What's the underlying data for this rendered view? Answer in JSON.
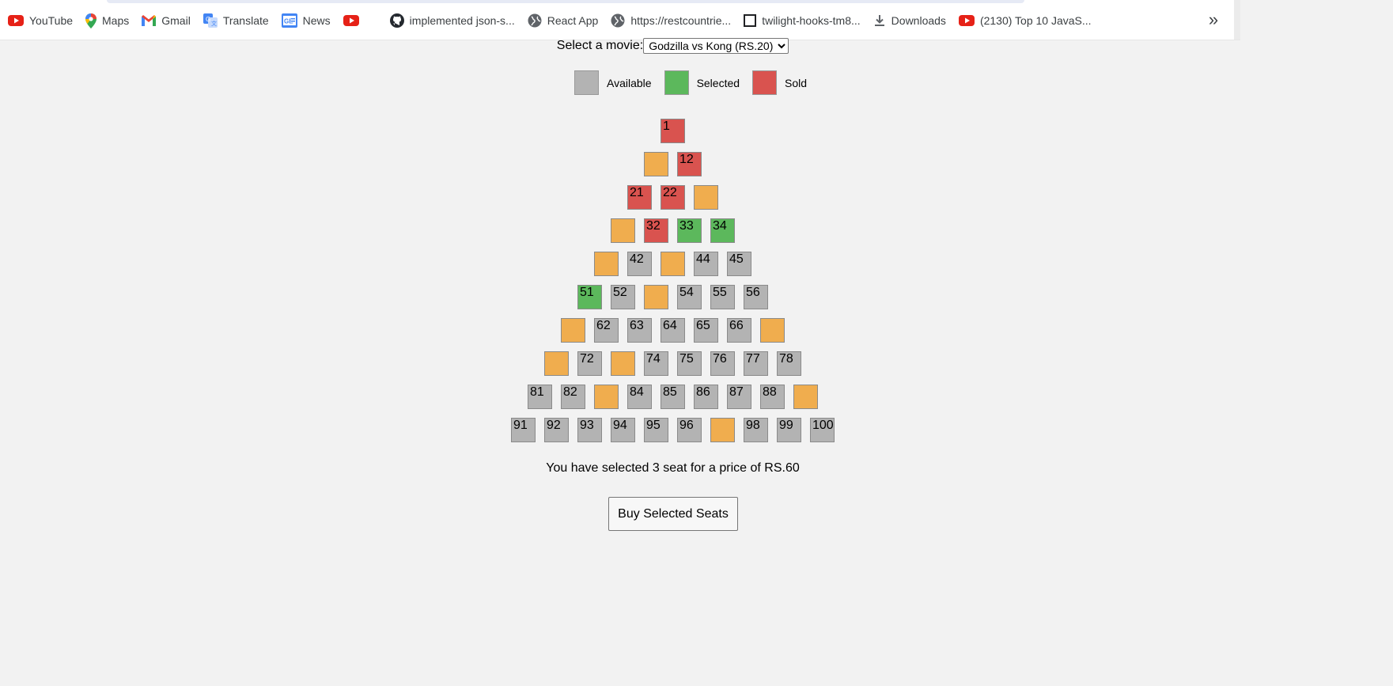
{
  "bookmarks_bar": {
    "items": [
      {
        "label": "YouTube"
      },
      {
        "label": "Maps"
      },
      {
        "label": "Gmail"
      },
      {
        "label": "Translate"
      },
      {
        "label": "News"
      },
      {
        "label": ""
      },
      {
        "label": "implemented json-s..."
      },
      {
        "label": "React App"
      },
      {
        "label": "https://restcountrie..."
      },
      {
        "label": "twilight-hooks-tm8..."
      },
      {
        "label": "Downloads"
      },
      {
        "label": "(2130) Top 10 JavaS..."
      }
    ],
    "overflow_label": "»"
  },
  "movie_picker": {
    "label": "Select a movie:",
    "selected": "Godzilla vs Kong (RS.20)"
  },
  "legend": {
    "available": "Available",
    "selected": "Selected",
    "sold": "Sold"
  },
  "status_colors": {
    "available": "#b3b3b3",
    "selected": "#5cb85c",
    "sold": "#d9534f",
    "empty": "#f0ad4e"
  },
  "seat_rows": [
    [
      {
        "n": "1",
        "s": "sold"
      }
    ],
    [
      {
        "n": "",
        "s": "empty"
      },
      {
        "n": "12",
        "s": "sold"
      }
    ],
    [
      {
        "n": "21",
        "s": "sold"
      },
      {
        "n": "22",
        "s": "sold"
      },
      {
        "n": "",
        "s": "empty"
      }
    ],
    [
      {
        "n": "",
        "s": "empty"
      },
      {
        "n": "32",
        "s": "sold"
      },
      {
        "n": "33",
        "s": "selected"
      },
      {
        "n": "34",
        "s": "selected"
      }
    ],
    [
      {
        "n": "",
        "s": "empty"
      },
      {
        "n": "42",
        "s": "available"
      },
      {
        "n": "",
        "s": "empty"
      },
      {
        "n": "44",
        "s": "available"
      },
      {
        "n": "45",
        "s": "available"
      }
    ],
    [
      {
        "n": "51",
        "s": "selected"
      },
      {
        "n": "52",
        "s": "available"
      },
      {
        "n": "",
        "s": "empty"
      },
      {
        "n": "54",
        "s": "available"
      },
      {
        "n": "55",
        "s": "available"
      },
      {
        "n": "56",
        "s": "available"
      }
    ],
    [
      {
        "n": "",
        "s": "empty"
      },
      {
        "n": "62",
        "s": "available"
      },
      {
        "n": "63",
        "s": "available"
      },
      {
        "n": "64",
        "s": "available"
      },
      {
        "n": "65",
        "s": "available"
      },
      {
        "n": "66",
        "s": "available"
      },
      {
        "n": "",
        "s": "empty"
      }
    ],
    [
      {
        "n": "",
        "s": "empty"
      },
      {
        "n": "72",
        "s": "available"
      },
      {
        "n": "",
        "s": "empty"
      },
      {
        "n": "74",
        "s": "available"
      },
      {
        "n": "75",
        "s": "available"
      },
      {
        "n": "76",
        "s": "available"
      },
      {
        "n": "77",
        "s": "available"
      },
      {
        "n": "78",
        "s": "available"
      }
    ],
    [
      {
        "n": "81",
        "s": "available"
      },
      {
        "n": "82",
        "s": "available"
      },
      {
        "n": "",
        "s": "empty"
      },
      {
        "n": "84",
        "s": "available"
      },
      {
        "n": "85",
        "s": "available"
      },
      {
        "n": "86",
        "s": "available"
      },
      {
        "n": "87",
        "s": "available"
      },
      {
        "n": "88",
        "s": "available"
      },
      {
        "n": "",
        "s": "empty"
      }
    ],
    [
      {
        "n": "91",
        "s": "available"
      },
      {
        "n": "92",
        "s": "available"
      },
      {
        "n": "93",
        "s": "available"
      },
      {
        "n": "94",
        "s": "available"
      },
      {
        "n": "95",
        "s": "available"
      },
      {
        "n": "96",
        "s": "available"
      },
      {
        "n": "",
        "s": "empty"
      },
      {
        "n": "98",
        "s": "available"
      },
      {
        "n": "99",
        "s": "available"
      },
      {
        "n": "100",
        "s": "available"
      }
    ]
  ],
  "summary": "You have selected 3 seat for a price of RS.60",
  "buy_button": "Buy Selected Seats"
}
